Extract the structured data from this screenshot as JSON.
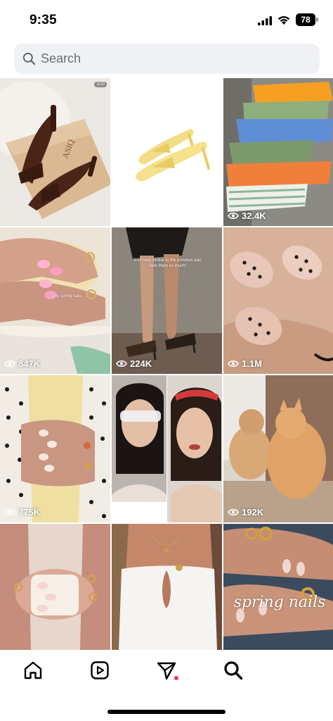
{
  "status_bar": {
    "time": "9:35",
    "battery_level": "78",
    "icons": [
      "signal-icon",
      "wifi-icon",
      "battery-icon"
    ]
  },
  "search": {
    "placeholder": "Search",
    "value": "",
    "icon": "search-icon"
  },
  "grid": {
    "tiles": [
      {
        "name": "tile-sandals-brown",
        "views": "",
        "badge": "1/10",
        "caption": ""
      },
      {
        "name": "tile-sandals-yellow",
        "views": "",
        "badge": "",
        "caption": ""
      },
      {
        "name": "tile-swimwear-stack",
        "views": "32.4K",
        "badge": "",
        "caption": ""
      },
      {
        "name": "tile-pink-nails-candle",
        "views": "847K",
        "badge": "",
        "caption": "girly spring nails"
      },
      {
        "name": "tile-legs-heels",
        "views": "224K",
        "badge": "",
        "caption": "9/10 very similar to the previous pair, love them so much!"
      },
      {
        "name": "tile-polka-dot-nails",
        "views": "1.1M",
        "badge": "",
        "caption": ""
      },
      {
        "name": "tile-polka-dot-hands",
        "views": "775K",
        "badge": "",
        "caption": ""
      },
      {
        "name": "tile-two-portraits",
        "views": "",
        "badge": "",
        "caption": ""
      },
      {
        "name": "tile-cats-mirror",
        "views": "192K",
        "badge": "",
        "caption": ""
      },
      {
        "name": "tile-nails-mug",
        "views": "",
        "badge": "",
        "caption": ""
      },
      {
        "name": "tile-white-top",
        "views": "",
        "badge": "",
        "caption": ""
      },
      {
        "name": "tile-spring-nails",
        "views": "",
        "badge": "",
        "caption": "spring nails"
      }
    ]
  },
  "nav": {
    "items": [
      {
        "name": "home",
        "icon": "home-icon"
      },
      {
        "name": "reels",
        "icon": "reels-icon"
      },
      {
        "name": "messages",
        "icon": "send-icon"
      },
      {
        "name": "search",
        "icon": "search-icon",
        "active": true
      }
    ]
  },
  "colors": {
    "notification_dot": "#ff2d55",
    "search_bg": "#eff1f4"
  }
}
